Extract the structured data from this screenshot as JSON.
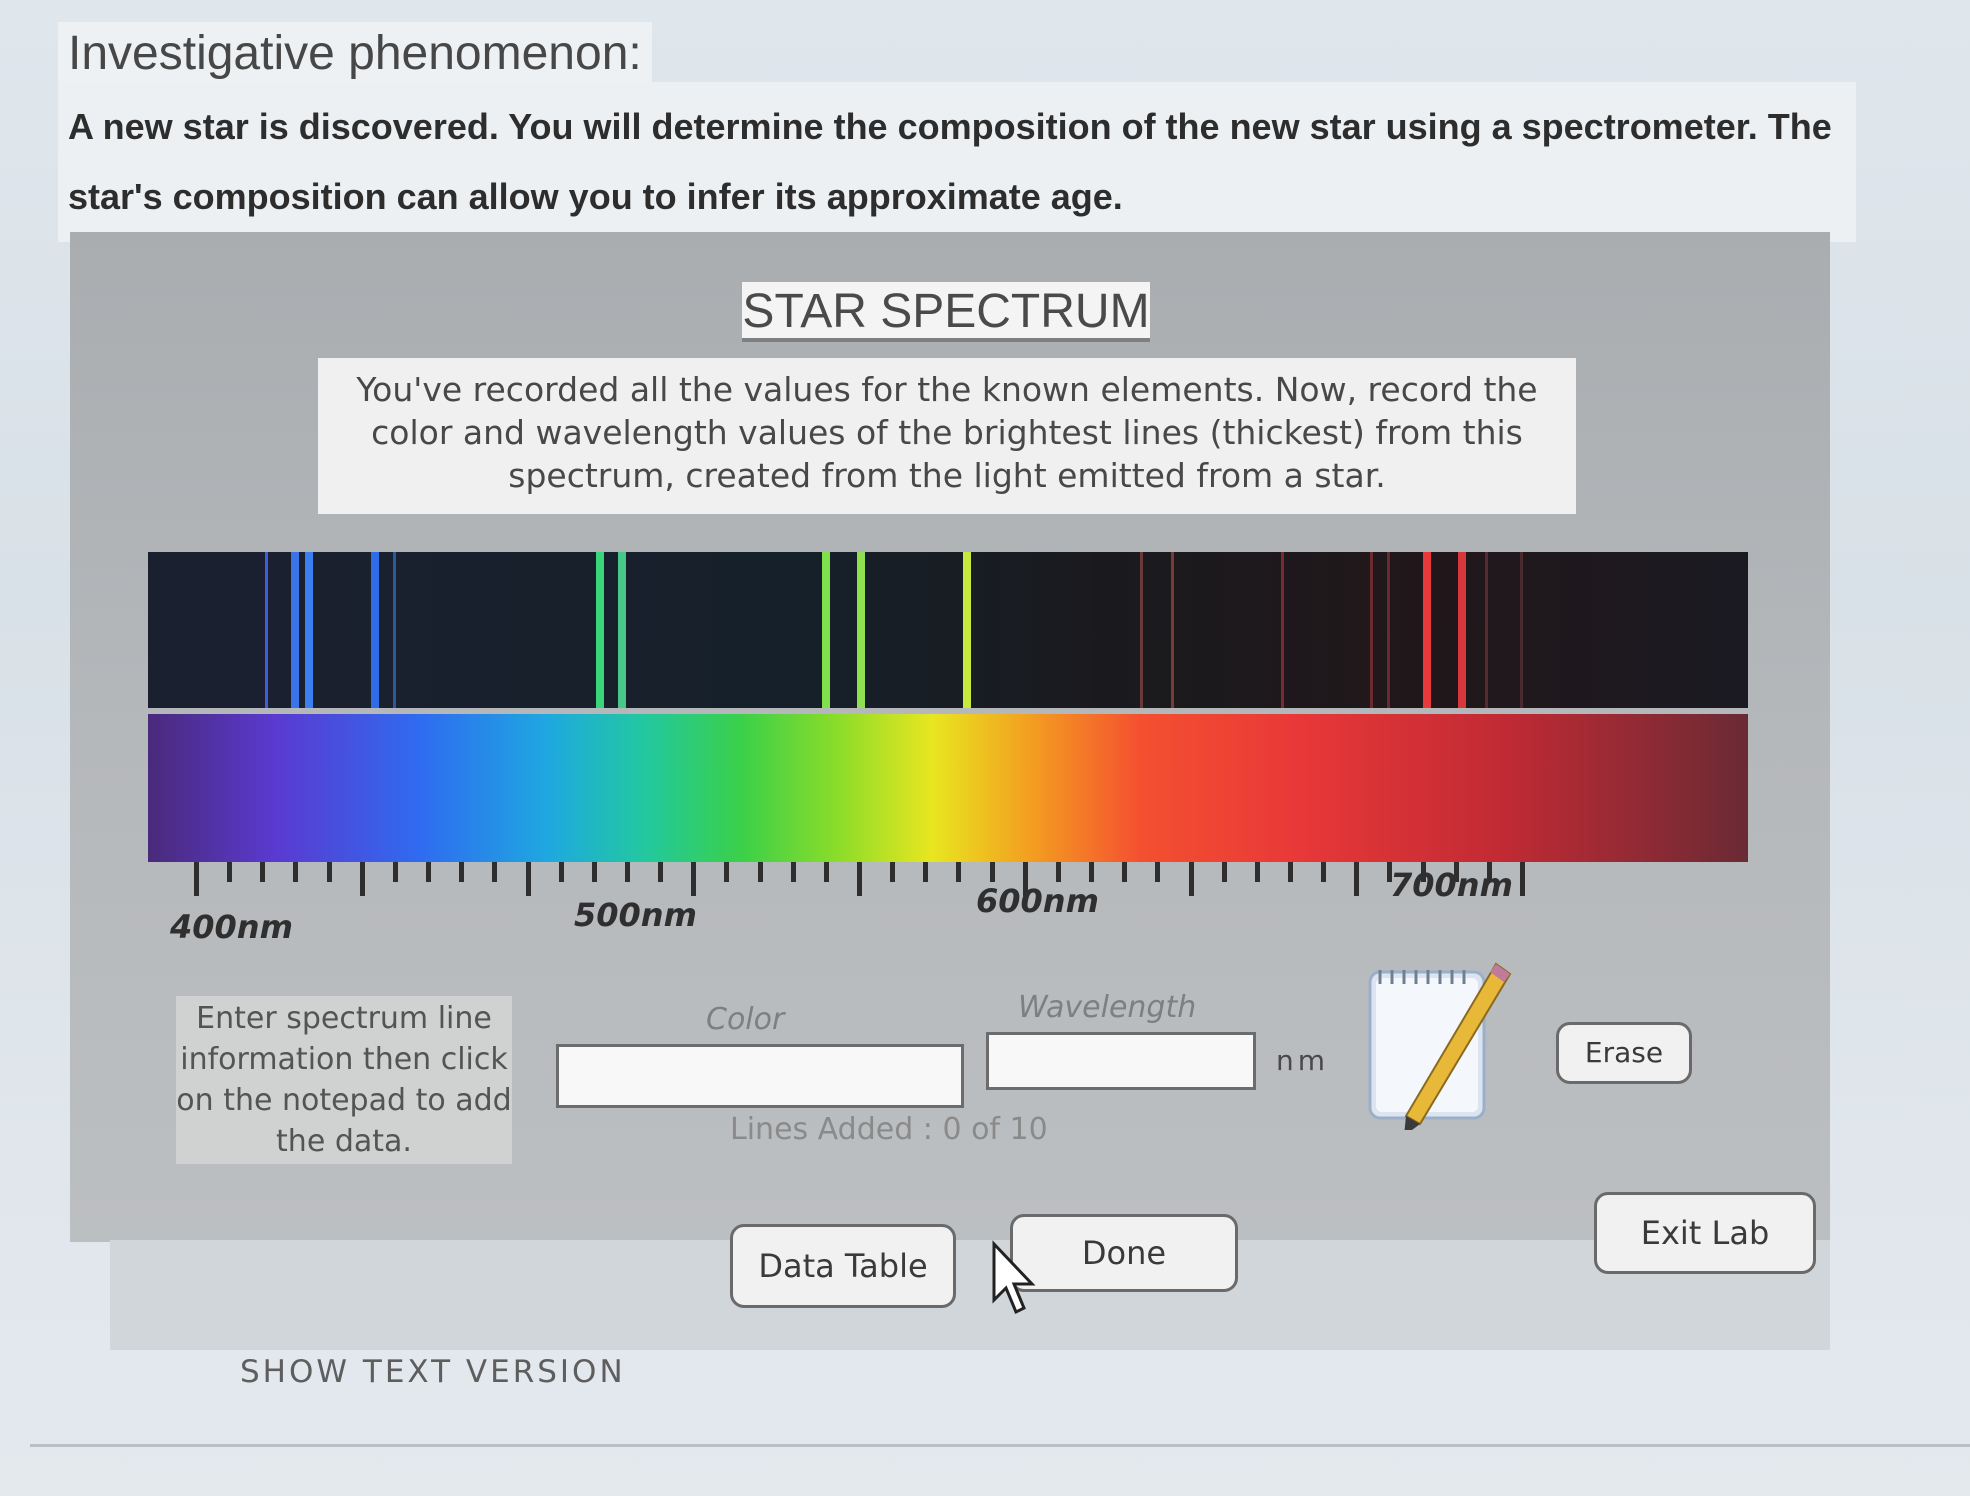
{
  "page": {
    "heading": "Investigative phenomenon:",
    "intro": "A new star is discovered. You will determine the composition of the new star using a spectrometer. The star's composition can allow you to infer its approximate age."
  },
  "lab": {
    "title": "STAR SPECTRUM",
    "instructions": "You've recorded all the values for the known elements. Now, record the color and wavelength values of the brightest lines (thickest) from this spectrum, created from the light emitted from a star.",
    "axis_labels": [
      "400nm",
      "500nm",
      "600nm",
      "700nm"
    ],
    "emission_lines": [
      {
        "wavelength": 416,
        "color": "#3a5fe0"
      },
      {
        "wavelength": 422,
        "color": "#3a74e8"
      },
      {
        "wavelength": 425,
        "color": "#3b80f0"
      },
      {
        "wavelength": 440,
        "color": "#2e6ce8"
      },
      {
        "wavelength": 445,
        "color": "#2b5a9a"
      },
      {
        "wavelength": 491,
        "color": "#3ad47a"
      },
      {
        "wavelength": 496,
        "color": "#48c888"
      },
      {
        "wavelength": 542,
        "color": "#7ee04a"
      },
      {
        "wavelength": 550,
        "color": "#8ee050"
      },
      {
        "wavelength": 574,
        "color": "#c8e840"
      },
      {
        "wavelength": 614,
        "color": "#6a3a38"
      },
      {
        "wavelength": 621,
        "color": "#7a3a3a"
      },
      {
        "wavelength": 646,
        "color": "#7a2a30"
      },
      {
        "wavelength": 666,
        "color": "#6a2a2e"
      },
      {
        "wavelength": 670,
        "color": "#6a2a2e"
      },
      {
        "wavelength": 678,
        "color": "#e83a3a"
      },
      {
        "wavelength": 686,
        "color": "#d8383c"
      },
      {
        "wavelength": 692,
        "color": "#5a2a2e"
      },
      {
        "wavelength": 700,
        "color": "#4a2a2e"
      }
    ],
    "enter_prompt": "Enter spectrum line information then click on the notepad to add the data.",
    "color_label": "Color",
    "wavelength_label": "Wavelength",
    "color_value": "",
    "wavelength_value": "",
    "unit": "nm",
    "lines_added": "Lines Added : 0 of 10",
    "erase_label": "Erase",
    "data_table_label": "Data Table",
    "done_label": "Done",
    "exit_label": "Exit Lab",
    "notepad_icon": "notepad-icon",
    "pencil_icon": "pencil-icon"
  },
  "show_text_version": "SHOW TEXT VERSION"
}
